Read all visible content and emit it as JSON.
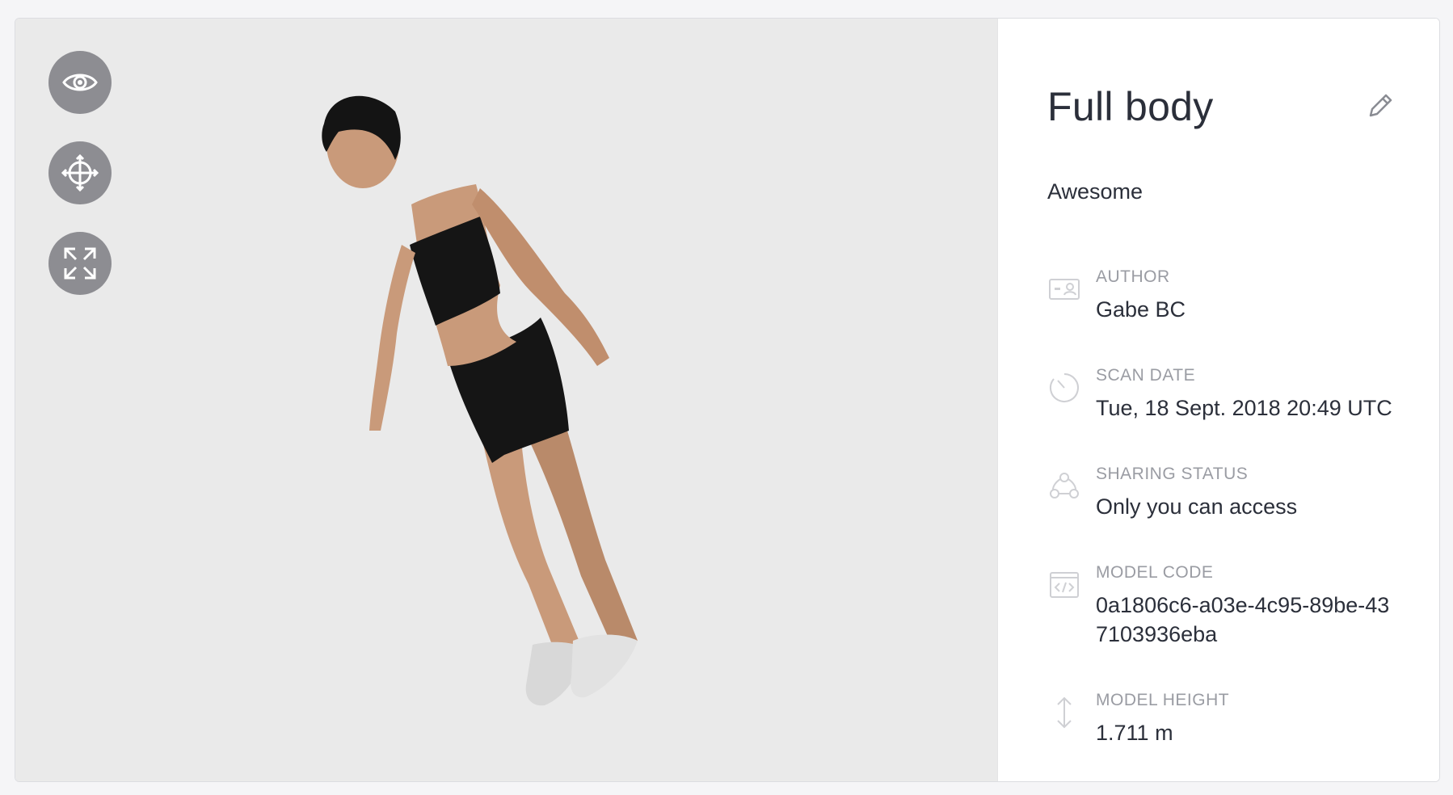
{
  "viewer": {
    "tools": [
      {
        "name": "view",
        "icon": "eye-icon"
      },
      {
        "name": "move",
        "icon": "move-crosshair-icon"
      },
      {
        "name": "fullscreen",
        "icon": "expand-icon"
      }
    ],
    "colors": {
      "background": "#eaeaea",
      "tool_button": "#8d8d92"
    }
  },
  "model": {
    "title": "Full body",
    "description": "Awesome",
    "edit_icon": "pencil-icon"
  },
  "fields": {
    "author": {
      "label": "AUTHOR",
      "value": "Gabe BC",
      "icon": "id-card-icon"
    },
    "scan_date": {
      "label": "SCAN DATE",
      "value": "Tue, 18 Sept. 2018 20:49 UTC",
      "icon": "clock-icon"
    },
    "sharing_status": {
      "label": "SHARING STATUS",
      "value": "Only you can access",
      "icon": "share-nodes-icon"
    },
    "model_code": {
      "label": "MODEL CODE",
      "value": "0a1806c6-a03e-4c95-89be-437103936eba",
      "icon": "code-window-icon"
    },
    "model_height": {
      "label": "MODEL HEIGHT",
      "value": "1.711 m",
      "icon": "vertical-arrows-icon"
    }
  }
}
